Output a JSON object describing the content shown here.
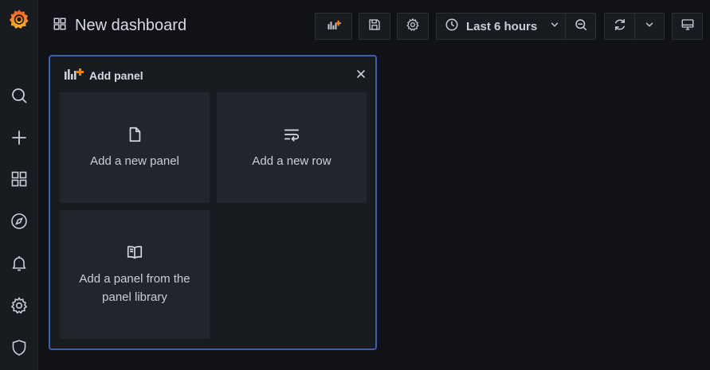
{
  "app": {
    "logo": "grafana-logo",
    "accent_color": "#f05a28"
  },
  "sidebar": {
    "items": [
      {
        "name": "search",
        "icon": "search-icon"
      },
      {
        "name": "create",
        "icon": "plus-icon"
      },
      {
        "name": "dashboards",
        "icon": "dashboards-grid-icon"
      },
      {
        "name": "explore",
        "icon": "compass-icon"
      },
      {
        "name": "alerting",
        "icon": "bell-icon"
      },
      {
        "name": "configuration",
        "icon": "gear-icon"
      },
      {
        "name": "server-admin",
        "icon": "shield-icon"
      }
    ]
  },
  "header": {
    "title": "New dashboard",
    "title_icon": "dashboards-grid-icon"
  },
  "toolbar": {
    "add_panel_icon": "add-panel-icon",
    "save_icon": "save-icon",
    "settings_icon": "gear-icon",
    "time_range_label": "Last 6 hours",
    "zoom_out_icon": "zoom-out-icon",
    "refresh_icon": "refresh-icon",
    "tv_mode_icon": "monitor-icon"
  },
  "add_panel": {
    "title": "Add panel",
    "options": [
      {
        "label": "Add a new panel",
        "icon": "file-icon"
      },
      {
        "label": "Add a new row",
        "icon": "row-wrap-icon"
      },
      {
        "label": "Add a panel from the panel library",
        "icon": "book-icon"
      }
    ]
  }
}
